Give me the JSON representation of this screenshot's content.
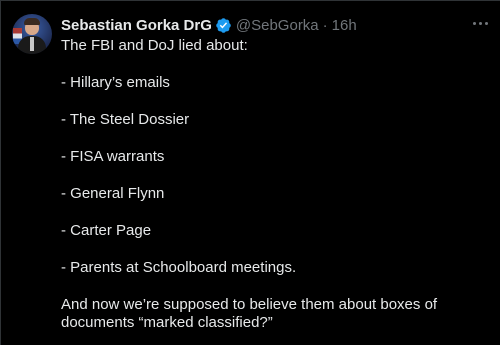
{
  "tweet": {
    "author_name": "Sebastian Gorka DrG",
    "handle": "@SebGorka",
    "separator": "·",
    "time": "16h",
    "verified_color": "#1d9bf0",
    "lines": [
      "The FBI and DoJ lied about:",
      "- Hillary’s emails",
      "- The Steel Dossier",
      "- FISA warrants",
      "- General Flynn",
      "- Carter Page",
      "- Parents at Schoolboard meetings.",
      "And now we’re supposed to believe them about boxes of",
      "documents “marked classified?”"
    ]
  }
}
